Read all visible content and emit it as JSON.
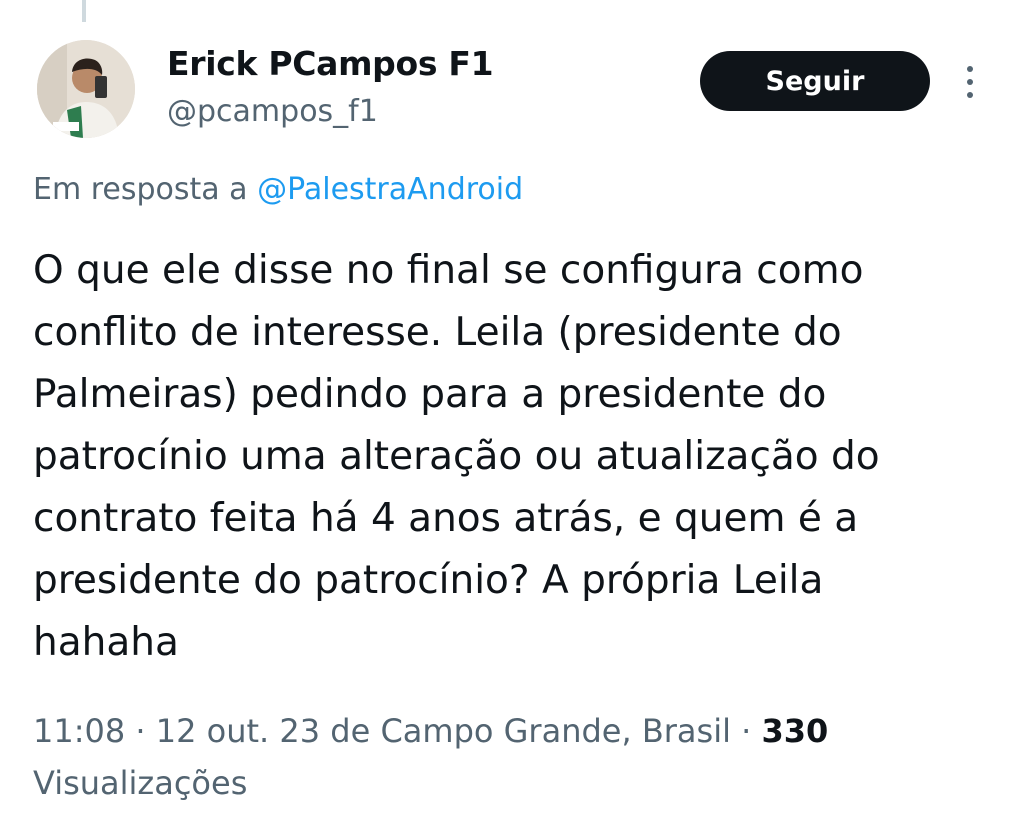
{
  "author": {
    "display_name": "Erick PCampos F1",
    "handle": "@pcampos_f1",
    "avatar_icon": "user-avatar-photo"
  },
  "actions": {
    "follow_label": "Seguir",
    "more_icon": "more-vertical-icon"
  },
  "reply": {
    "prefix": "Em resposta a",
    "mention": "@PalestraAndroid"
  },
  "tweet": {
    "lines": [
      "O que ele disse no final se configura como",
      "conflito de interesse. Leila (presidente do",
      "Palmeiras) pedindo para a presidente do",
      "patrocínio uma alteração ou atualização do",
      "contrato feita há 4 anos atrás, e quem é a",
      "presidente do patrocínio? A própria Leila",
      "hahaha"
    ]
  },
  "meta": {
    "time": "11:08",
    "date": "12 out. 23",
    "location": "de Campo Grande, Brasil",
    "separator": "·",
    "views_count": "330",
    "views_label": "Visualizações"
  },
  "colors": {
    "text": "#0f1419",
    "secondary": "#536471",
    "link": "#1d9bf0",
    "button_bg": "#0f1419"
  }
}
